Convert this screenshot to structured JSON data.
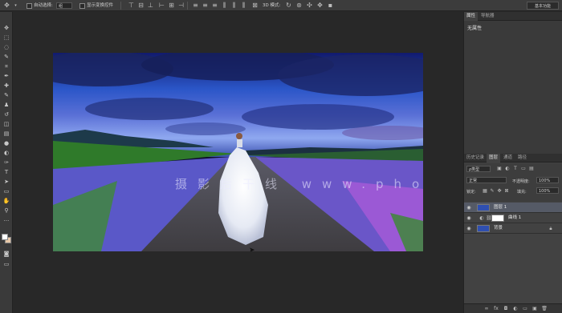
{
  "options_bar": {
    "auto_select_label": "自动选择:",
    "auto_select_value": "组",
    "show_transform_label": "显示变换控件",
    "mode_3d_label": "3D 模式:",
    "workspace": "基本功能"
  },
  "properties_panel": {
    "tabs": [
      "属性",
      "导航器"
    ],
    "message": "无属性"
  },
  "layers_panel": {
    "tabs": [
      "历史记录",
      "图层",
      "通道",
      "路径"
    ],
    "kind_filter": "ρ类型",
    "blend_mode": "正常",
    "opacity_label": "不透明度:",
    "opacity_value": "100%",
    "lock_label": "锁定:",
    "fill_label": "填充:",
    "fill_value": "100%",
    "layers": [
      {
        "name": "图层 1",
        "visible": true,
        "selected": true
      },
      {
        "name": "曲线 1",
        "visible": true,
        "selected": false
      },
      {
        "name": "背景",
        "visible": true,
        "selected": false
      }
    ]
  },
  "canvas": {
    "watermark": "摄影后干线 www.photoshopvip.net"
  },
  "colors": {
    "foreground": "#ffffff",
    "background": "#e8c8a8",
    "panel": "#424242",
    "workspace_bg": "#282828"
  },
  "icons": {
    "move_tool": "move-icon",
    "eye": "eye-icon"
  }
}
